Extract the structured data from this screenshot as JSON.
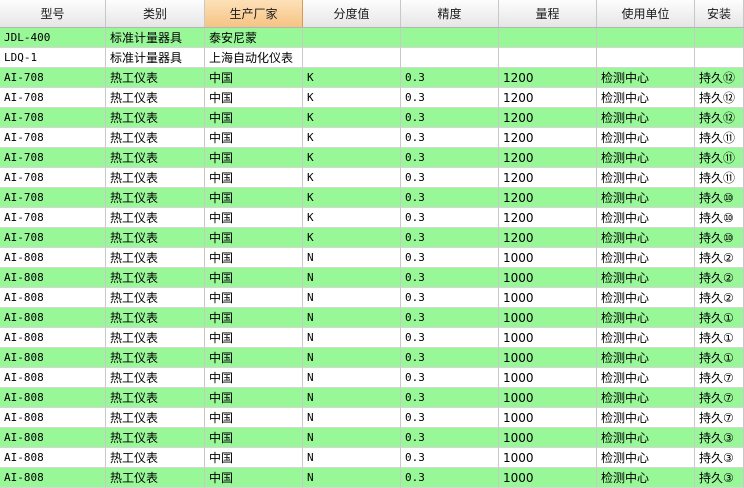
{
  "table": {
    "columns": [
      {
        "label": "型号",
        "mono": true
      },
      {
        "label": "类别",
        "mono": false
      },
      {
        "label": "生产厂家",
        "mono": false,
        "active": true
      },
      {
        "label": "分度值",
        "mono": true
      },
      {
        "label": "精度",
        "mono": true
      },
      {
        "label": "量程",
        "mono": false
      },
      {
        "label": "使用单位",
        "mono": false
      },
      {
        "label": "安装",
        "mono": false
      }
    ],
    "row_colors": {
      "green": "#98f898",
      "white": "#ffffff",
      "header_active": "#f6c384"
    },
    "rows": [
      {
        "stripe": "g",
        "cells": [
          "JDL-400",
          "标准计量器具",
          "泰安尼蒙",
          "",
          "",
          "",
          "",
          ""
        ]
      },
      {
        "stripe": "w",
        "cells": [
          "LDQ-1",
          "标准计量器具",
          "上海自动化仪表",
          "",
          "",
          "",
          "",
          ""
        ]
      },
      {
        "stripe": "g",
        "cells": [
          "AI-708",
          "热工仪表",
          "中国",
          "K",
          "0.3",
          "1200",
          "检测中心",
          "持久⑫"
        ]
      },
      {
        "stripe": "w",
        "cells": [
          "AI-708",
          "热工仪表",
          "中国",
          "K",
          "0.3",
          "1200",
          "检测中心",
          "持久⑫"
        ]
      },
      {
        "stripe": "g",
        "cells": [
          "AI-708",
          "热工仪表",
          "中国",
          "K",
          "0.3",
          "1200",
          "检测中心",
          "持久⑫"
        ]
      },
      {
        "stripe": "w",
        "cells": [
          "AI-708",
          "热工仪表",
          "中国",
          "K",
          "0.3",
          "1200",
          "检测中心",
          "持久⑪"
        ]
      },
      {
        "stripe": "g",
        "cells": [
          "AI-708",
          "热工仪表",
          "中国",
          "K",
          "0.3",
          "1200",
          "检测中心",
          "持久⑪"
        ]
      },
      {
        "stripe": "w",
        "cells": [
          "AI-708",
          "热工仪表",
          "中国",
          "K",
          "0.3",
          "1200",
          "检测中心",
          "持久⑪"
        ]
      },
      {
        "stripe": "g",
        "cells": [
          "AI-708",
          "热工仪表",
          "中国",
          "K",
          "0.3",
          "1200",
          "检测中心",
          "持久⑩"
        ]
      },
      {
        "stripe": "w",
        "cells": [
          "AI-708",
          "热工仪表",
          "中国",
          "K",
          "0.3",
          "1200",
          "检测中心",
          "持久⑩"
        ]
      },
      {
        "stripe": "g",
        "cells": [
          "AI-708",
          "热工仪表",
          "中国",
          "K",
          "0.3",
          "1200",
          "检测中心",
          "持久⑩"
        ]
      },
      {
        "stripe": "w",
        "cells": [
          "AI-808",
          "热工仪表",
          "中国",
          "N",
          "0.3",
          "1000",
          "检测中心",
          "持久②"
        ]
      },
      {
        "stripe": "g",
        "cells": [
          "AI-808",
          "热工仪表",
          "中国",
          "N",
          "0.3",
          "1000",
          "检测中心",
          "持久②"
        ]
      },
      {
        "stripe": "w",
        "cells": [
          "AI-808",
          "热工仪表",
          "中国",
          "N",
          "0.3",
          "1000",
          "检测中心",
          "持久②"
        ]
      },
      {
        "stripe": "g",
        "cells": [
          "AI-808",
          "热工仪表",
          "中国",
          "N",
          "0.3",
          "1000",
          "检测中心",
          "持久①"
        ]
      },
      {
        "stripe": "w",
        "cells": [
          "AI-808",
          "热工仪表",
          "中国",
          "N",
          "0.3",
          "1000",
          "检测中心",
          "持久①"
        ]
      },
      {
        "stripe": "g",
        "cells": [
          "AI-808",
          "热工仪表",
          "中国",
          "N",
          "0.3",
          "1000",
          "检测中心",
          "持久①"
        ]
      },
      {
        "stripe": "w",
        "cells": [
          "AI-808",
          "热工仪表",
          "中国",
          "N",
          "0.3",
          "1000",
          "检测中心",
          "持久⑦"
        ]
      },
      {
        "stripe": "g",
        "cells": [
          "AI-808",
          "热工仪表",
          "中国",
          "N",
          "0.3",
          "1000",
          "检测中心",
          "持久⑦"
        ]
      },
      {
        "stripe": "w",
        "cells": [
          "AI-808",
          "热工仪表",
          "中国",
          "N",
          "0.3",
          "1000",
          "检测中心",
          "持久⑦"
        ]
      },
      {
        "stripe": "g",
        "cells": [
          "AI-808",
          "热工仪表",
          "中国",
          "N",
          "0.3",
          "1000",
          "检测中心",
          "持久③"
        ]
      },
      {
        "stripe": "w",
        "cells": [
          "AI-808",
          "热工仪表",
          "中国",
          "N",
          "0.3",
          "1000",
          "检测中心",
          "持久③"
        ]
      },
      {
        "stripe": "g",
        "cells": [
          "AI-808",
          "热工仪表",
          "中国",
          "N",
          "0.3",
          "1000",
          "检测中心",
          "持久③"
        ]
      }
    ]
  }
}
